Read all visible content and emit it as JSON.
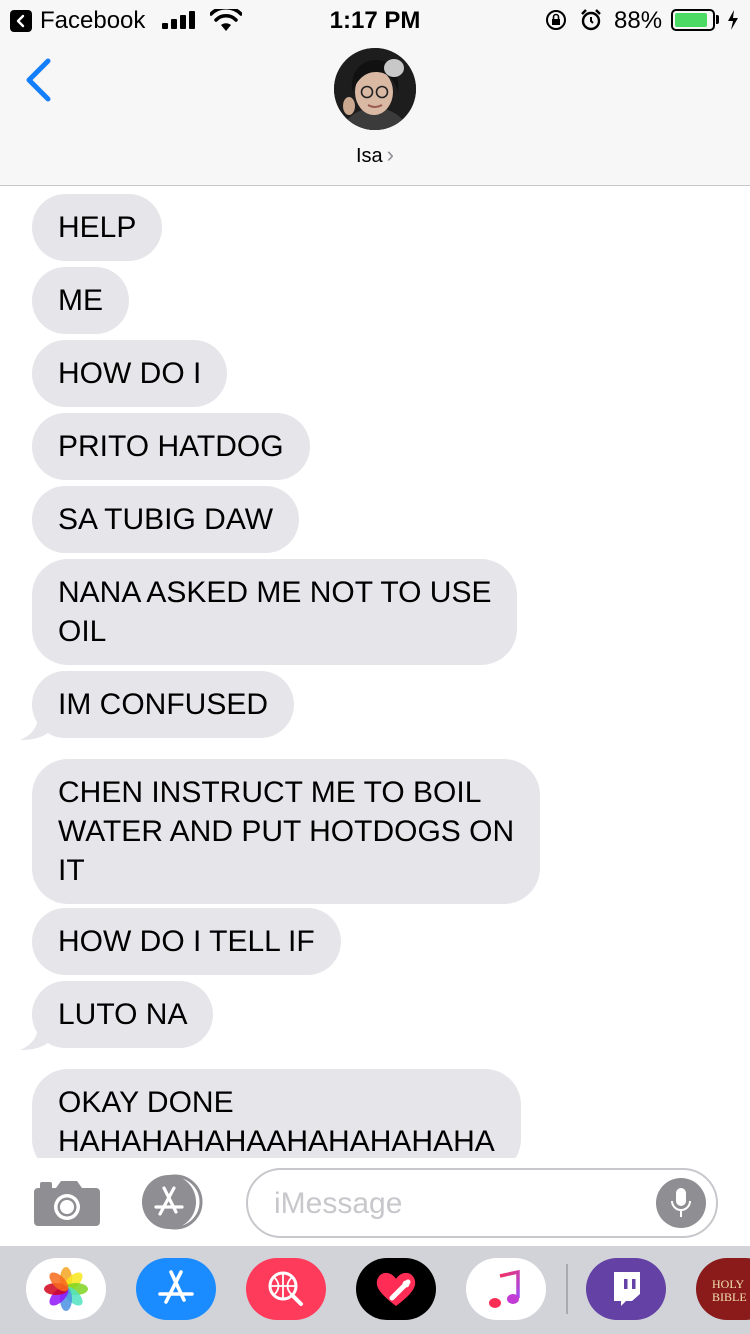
{
  "status_bar": {
    "back_app": "Facebook",
    "time": "1:17 PM",
    "battery_percent": "88%",
    "battery_level": 0.88,
    "icons": [
      "back-app-icon",
      "signal-icon",
      "wifi-icon",
      "orientation-lock-icon",
      "alarm-icon",
      "battery-icon",
      "charging-icon"
    ]
  },
  "header": {
    "contact_name": "Isa",
    "chevron": "›"
  },
  "messages": [
    {
      "text": "HELP"
    },
    {
      "text": "ME"
    },
    {
      "text": "HOW DO I"
    },
    {
      "text": "PRITO HATDOG"
    },
    {
      "text": "SA TUBIG DAW"
    },
    {
      "text": "NANA ASKED ME NOT TO USE\nOIL"
    },
    {
      "text": "IM CONFUSED"
    },
    {
      "text": "CHEN INSTRUCT ME TO BOIL\nWATER AND PUT HOTDOGS ON\nIT"
    },
    {
      "text": "HOW DO I TELL IF"
    },
    {
      "text": "LUTO NA"
    },
    {
      "text": "OKAY DONE\nHAHAHAHAHAAHAHAHAHAHA"
    }
  ],
  "input": {
    "placeholder": "iMessage"
  },
  "app_drawer": {
    "apps": [
      "photos",
      "app-store",
      "images-search",
      "digital-touch",
      "music",
      "twitch",
      "holy-bible"
    ],
    "bible_label": "HOLY\nBIBLE"
  },
  "colors": {
    "incoming_bubble": "#e5e5ea",
    "ios_blue": "#147efb",
    "battery_green": "#4cd964",
    "twitch_purple": "#6441a4"
  }
}
